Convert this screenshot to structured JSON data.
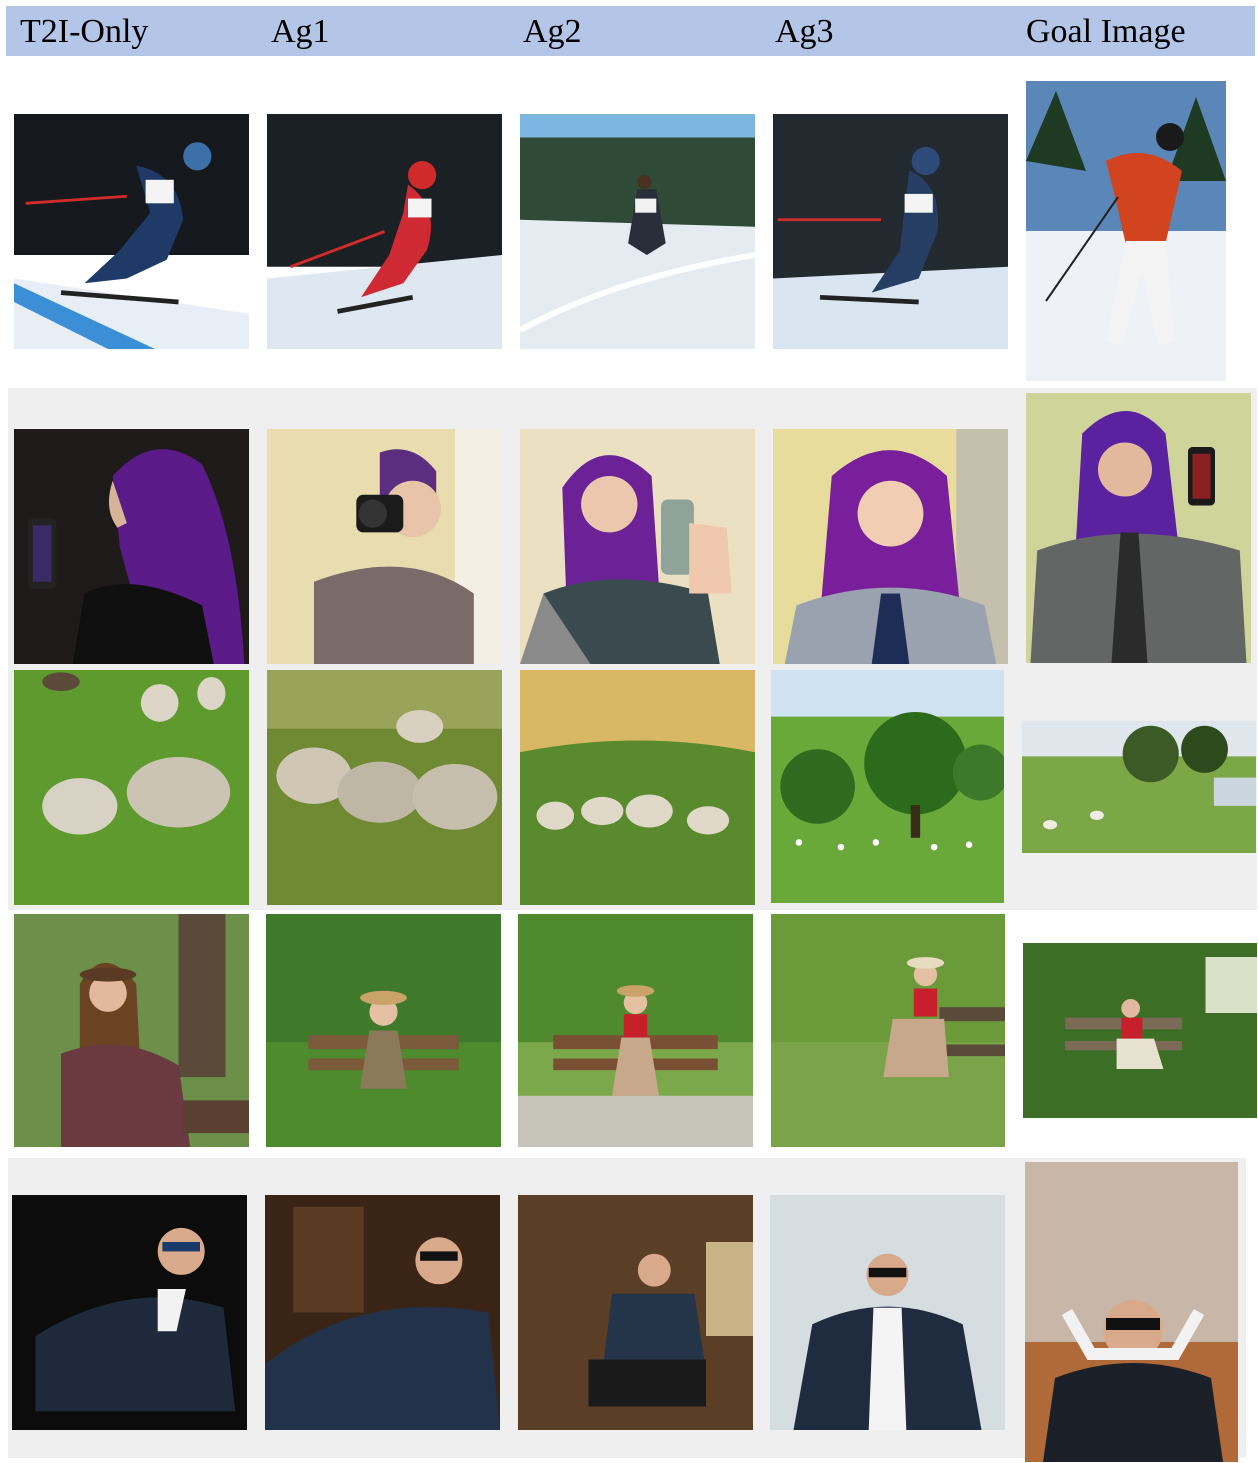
{
  "header": {
    "columns": [
      "T2I-Only",
      "Ag1",
      "Ag2",
      "Ag3",
      "Goal Image"
    ]
  },
  "rows": [
    {
      "theme": "skier",
      "colors": {
        "sky": "#1b1f24",
        "snow": "#e8eef5",
        "accent": "#d22b2b",
        "body": "#1f3a66"
      }
    },
    {
      "theme": "purple-hair-selfie",
      "colors": {
        "bg": "#e9dfc4",
        "hair": "#6a1fa0",
        "shirt": "#6f6f70",
        "skin": "#e6c2a6"
      }
    },
    {
      "theme": "sheep-meadow",
      "colors": {
        "grass": "#5f9a2e",
        "sky": "#d9c48a",
        "sheep": "#d8d2c4",
        "tree": "#2f6a1f"
      }
    },
    {
      "theme": "woman-on-bench",
      "colors": {
        "grass": "#6c9e3b",
        "leaves": "#3e7a2a",
        "bench": "#7a5a3a",
        "shirt": "#c8202a"
      }
    },
    {
      "theme": "man-in-suit-sunglasses",
      "colors": {
        "bg": "#2b2118",
        "suit": "#1e2a3c",
        "shirt": "#f2f2f2",
        "skin": "#d8a98a"
      }
    }
  ]
}
